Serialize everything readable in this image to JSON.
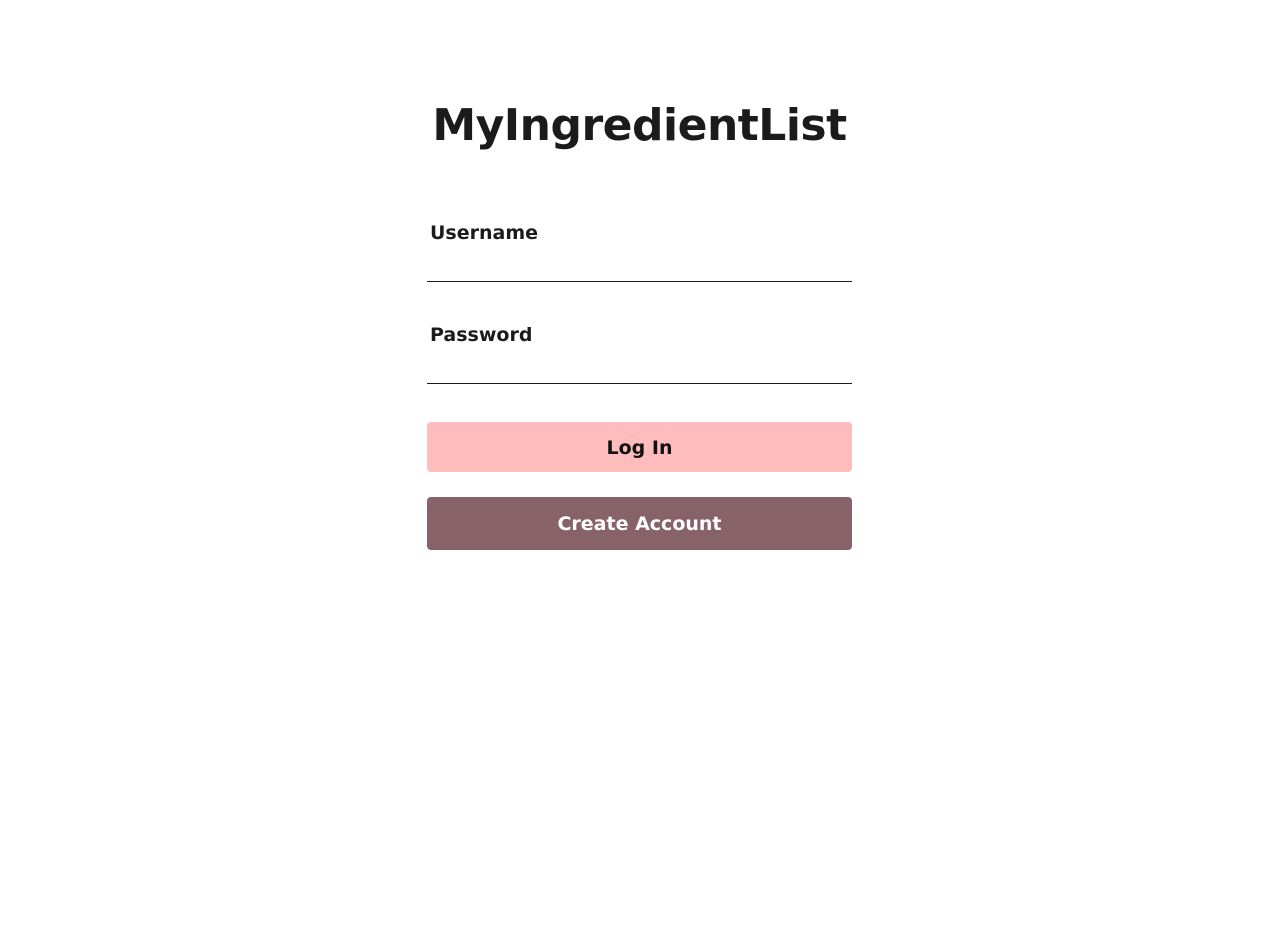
{
  "app": {
    "title": "MyIngredientList"
  },
  "login_form": {
    "username": {
      "label": "Username",
      "value": "",
      "placeholder": ""
    },
    "password": {
      "label": "Password",
      "value": "",
      "placeholder": ""
    },
    "login_button_label": "Log In",
    "create_account_button_label": "Create Account"
  },
  "colors": {
    "login_button": "#ffbcbc",
    "create_account_button": "#876268",
    "text": "#1c1b1b"
  }
}
